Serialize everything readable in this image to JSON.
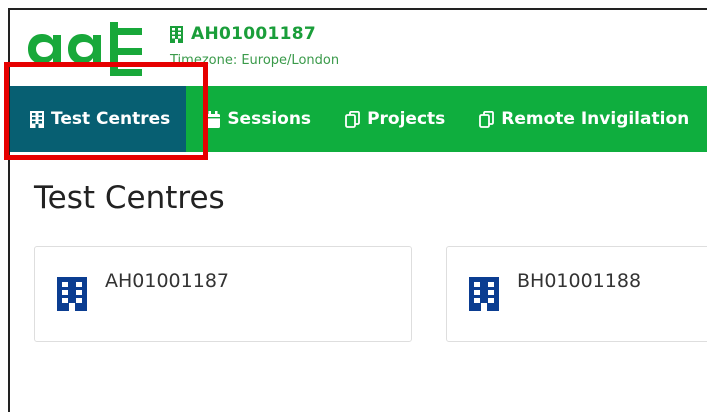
{
  "header": {
    "logo_text": "aat",
    "centre_code": "AH01001187",
    "timezone": "Timezone: Europe/London"
  },
  "nav": {
    "items": [
      {
        "label": "Test Centres",
        "icon": "building-icon",
        "active": true
      },
      {
        "label": "Sessions",
        "icon": "calendar-icon",
        "active": false
      },
      {
        "label": "Projects",
        "icon": "copy-icon",
        "active": false
      },
      {
        "label": "Remote Invigilation",
        "icon": "copy-icon",
        "active": false
      }
    ]
  },
  "main": {
    "title": "Test Centres",
    "cards": [
      {
        "code": "AH01001187",
        "icon": "building-icon"
      },
      {
        "code": "BH01001188",
        "icon": "building-icon"
      }
    ]
  },
  "colors": {
    "brand_green": "#0fae3e",
    "active_tab": "#075f72",
    "highlight_red": "#e60000",
    "icon_blue": "#0b3d91"
  }
}
